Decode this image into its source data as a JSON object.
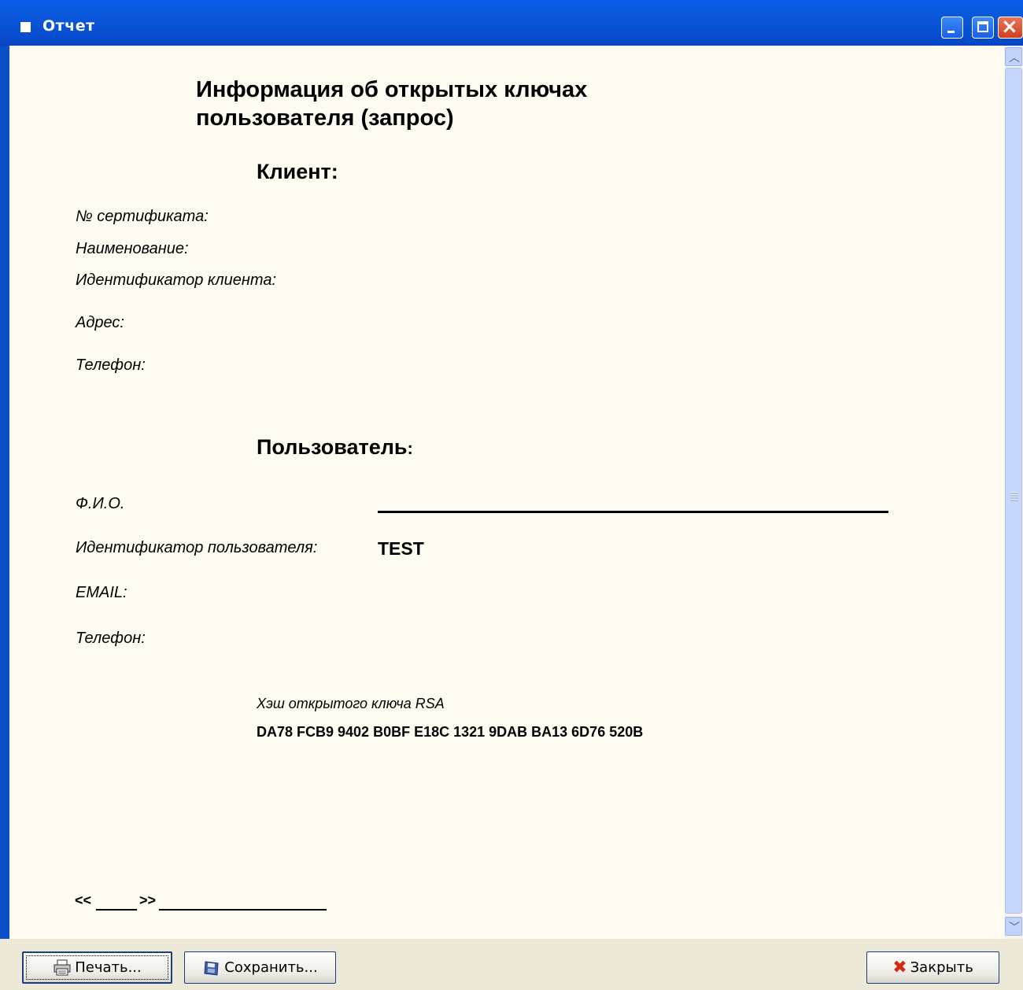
{
  "window": {
    "title": "Отчет"
  },
  "report": {
    "title_line1": "Информация об открытых ключах",
    "title_line2": "пользователя (запрос)",
    "client_heading": "Клиент:",
    "client_fields": {
      "cert_no": "№ сертификата:",
      "name": "Наименование:",
      "client_id": "Идентификатор клиента:",
      "address": "Адрес:",
      "phone": "Телефон:"
    },
    "user_heading": "Пользователь",
    "user_heading_colon": ":",
    "user_fields": {
      "fio": "Ф.И.О.",
      "user_id_label": "Идентификатор пользователя:",
      "user_id_value": "TEST",
      "email": "EMAIL:",
      "phone": "Телефон:"
    },
    "hash_label": "Хэш открытого ключа RSA",
    "hash_value": "DA78 FCB9 9402 B0BF E18C 1321 9DAB BA13 6D76 520B",
    "date_open": "<<",
    "date_close": ">>"
  },
  "buttons": {
    "print": "Печать...",
    "save": "Сохранить...",
    "close": "Закрыть"
  }
}
